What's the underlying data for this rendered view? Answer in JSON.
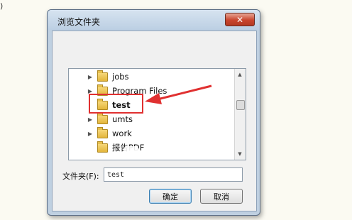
{
  "background": {
    "glyph": ")"
  },
  "dialog": {
    "title": "浏览文件夹",
    "close_glyph": "✕",
    "tree": {
      "items": [
        {
          "label": "jobs",
          "expandable": true
        },
        {
          "label": "Program Files",
          "expandable": true
        },
        {
          "label": "test",
          "expandable": false,
          "selected": true
        },
        {
          "label": "umts",
          "expandable": true
        },
        {
          "label": "work",
          "expandable": true
        },
        {
          "label": "报告PDF",
          "expandable": false
        }
      ],
      "expander_glyph": "▶",
      "scroll_up_glyph": "▲",
      "scroll_down_glyph": "▼"
    },
    "folder_field": {
      "label": "文件夹(F):",
      "value": "test"
    },
    "ok_label": "确定",
    "cancel_label": "取消"
  },
  "colors": {
    "annotation_red": "#e03030",
    "folder_yellow": "#f0c95a"
  }
}
